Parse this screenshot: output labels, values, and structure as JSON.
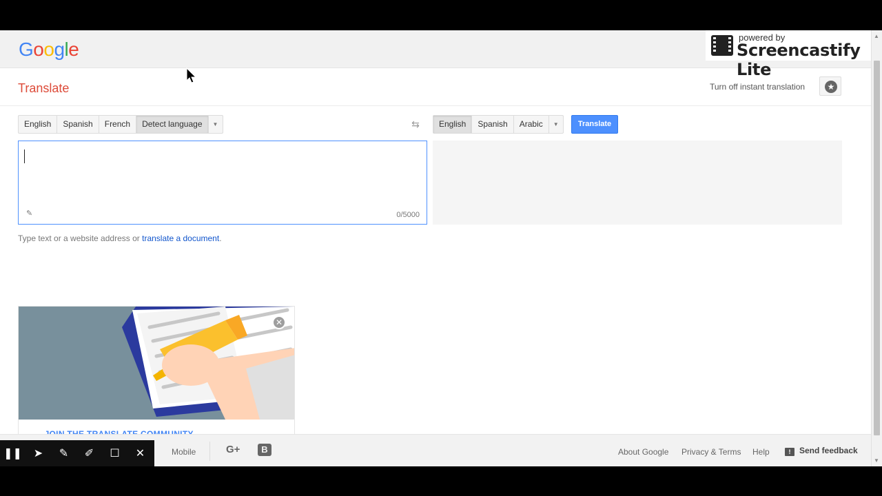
{
  "brand": {
    "logo_letters": [
      {
        "ch": "G",
        "color": "#4285f4"
      },
      {
        "ch": "o",
        "color": "#ea4335"
      },
      {
        "ch": "o",
        "color": "#fbbc05"
      },
      {
        "ch": "g",
        "color": "#4285f4"
      },
      {
        "ch": "l",
        "color": "#34a853"
      },
      {
        "ch": "e",
        "color": "#ea4335"
      }
    ]
  },
  "watermark": {
    "powered_by": "powered by",
    "product": "Screencastify Lite"
  },
  "header": {
    "title": "Translate",
    "instant_toggle": "Turn off instant translation",
    "star_icon": "star-icon"
  },
  "source": {
    "languages": [
      {
        "label": "English",
        "active": false
      },
      {
        "label": "Spanish",
        "active": false
      },
      {
        "label": "French",
        "active": false
      },
      {
        "label": "Detect language",
        "active": true
      }
    ],
    "input_value": "",
    "char_count": "0/5000"
  },
  "target": {
    "languages": [
      {
        "label": "English",
        "active": true
      },
      {
        "label": "Spanish",
        "active": false
      },
      {
        "label": "Arabic",
        "active": false
      }
    ],
    "translate_label": "Translate"
  },
  "hint": {
    "prefix": "Type text or a website address or",
    "link": "translate a document",
    "suffix": "."
  },
  "community": {
    "link_text": "JOIN THE TRANSLATE COMMUNITY"
  },
  "footer": {
    "mobile": "Mobile",
    "gplus": "G+",
    "blogger": "B",
    "about": "About Google",
    "privacy": "Privacy & Terms",
    "help": "Help",
    "feedback": "Send feedback"
  },
  "recorder_tools": [
    {
      "name": "pause-icon",
      "glyph": "❚❚"
    },
    {
      "name": "pointer-icon",
      "glyph": "➤"
    },
    {
      "name": "pen-icon",
      "glyph": "✎"
    },
    {
      "name": "highlighter-icon",
      "glyph": "✐"
    },
    {
      "name": "rectangle-icon",
      "glyph": "☐"
    },
    {
      "name": "close-icon",
      "glyph": "✕"
    }
  ],
  "colors": {
    "accent": "#dd4b39",
    "primary_button": "#4d90fe",
    "link": "#1155cc"
  }
}
